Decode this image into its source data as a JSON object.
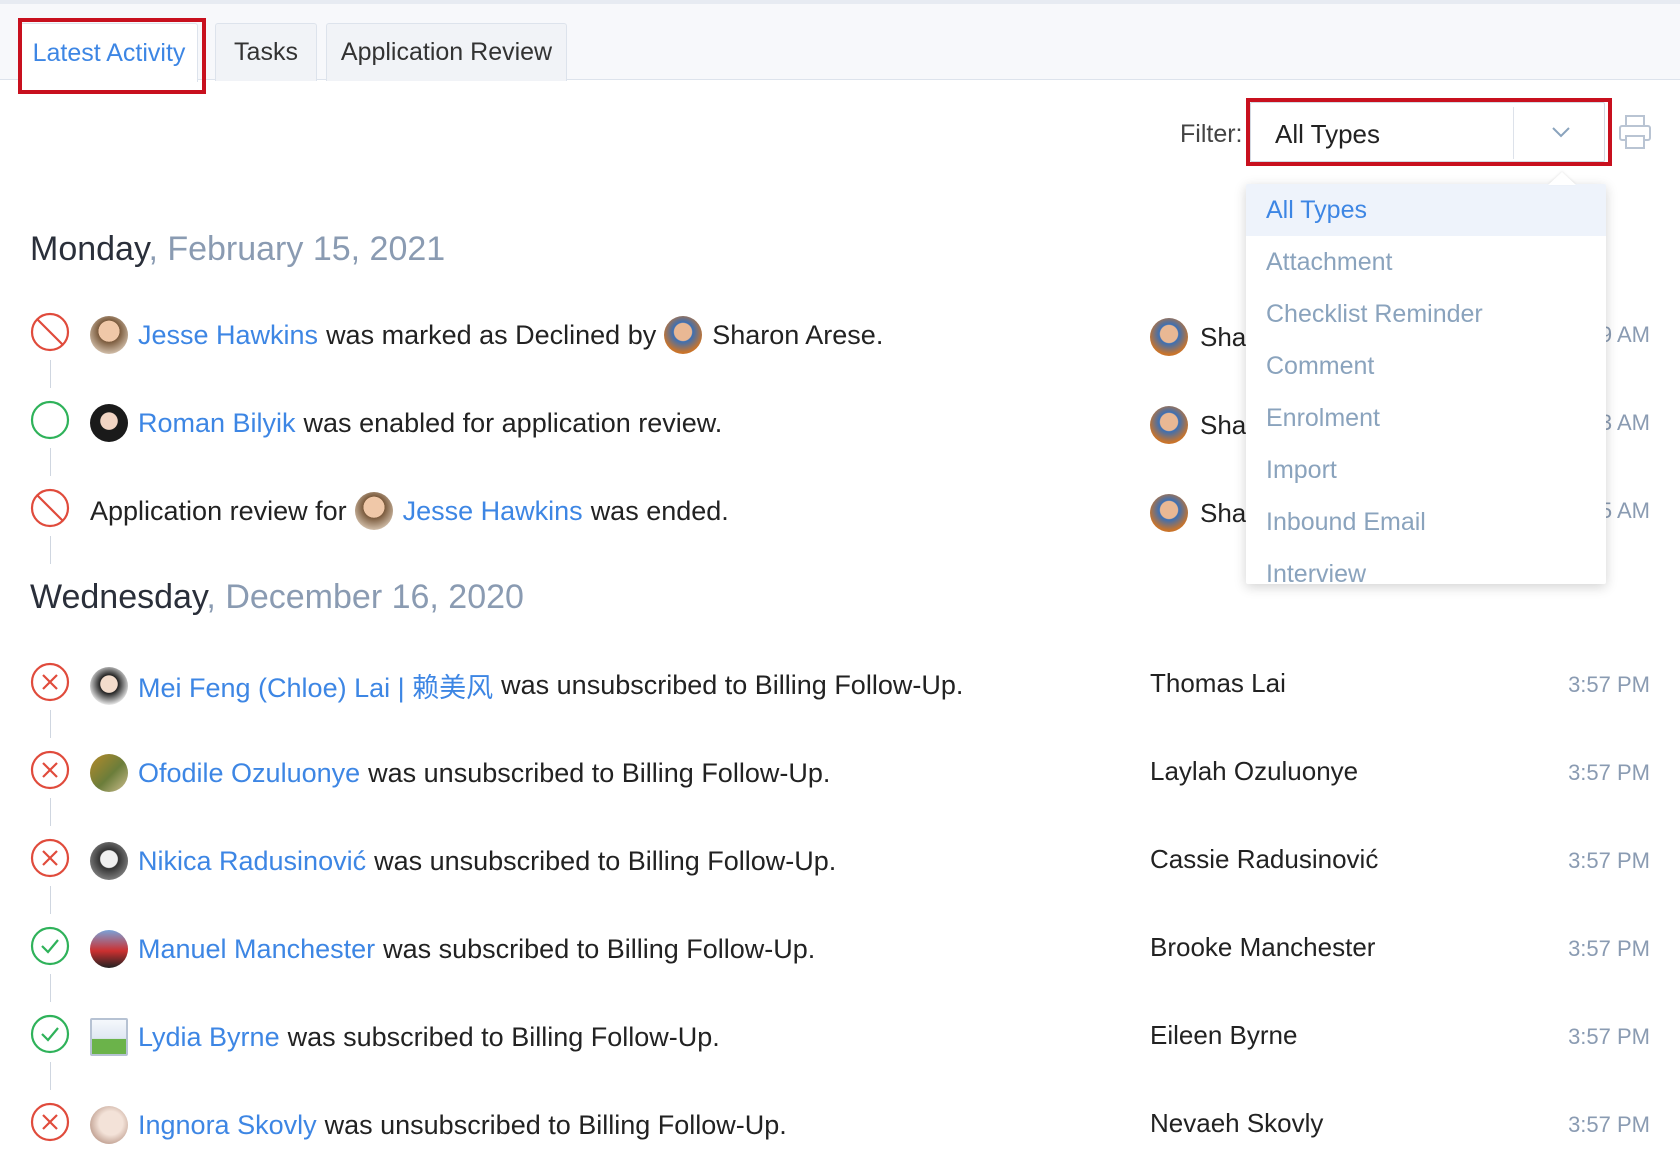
{
  "tabs": [
    {
      "label": "Latest Activity",
      "active": true
    },
    {
      "label": "Tasks",
      "active": false
    },
    {
      "label": "Application Review",
      "active": false
    }
  ],
  "filter": {
    "label": "Filter:",
    "selected": "All Types",
    "options": [
      "All Types",
      "Attachment",
      "Checklist Reminder",
      "Comment",
      "Enrolment",
      "Import",
      "Inbound Email",
      "Interview"
    ]
  },
  "days": [
    {
      "weekday": "Monday",
      "date": ", February 15, 2021"
    },
    {
      "weekday": "Wednesday",
      "date": ", December 16, 2020"
    }
  ],
  "activities": [
    {
      "status": "declined",
      "before": "",
      "name": "Jesse Hawkins",
      "after": "was marked as Declined by",
      "by": "Sharon Arese.",
      "actor": "Sha",
      "time": "9 AM"
    },
    {
      "status": "enabled",
      "before": "",
      "name": "Roman Bilyik",
      "after": "was enabled for application review.",
      "by": "",
      "actor": "Sha",
      "time": "3 AM"
    },
    {
      "status": "declined",
      "before": "Application review for",
      "name": "Jesse Hawkins",
      "after": "was ended.",
      "by": "",
      "actor": "Sha",
      "time": "5 AM"
    },
    {
      "status": "unsubscribed",
      "before": "",
      "name": "Mei Feng (Chloe) Lai | 赖美风",
      "after": "was unsubscribed to Billing Follow-Up.",
      "by": "",
      "actor": "Thomas Lai",
      "time": "3:57 PM"
    },
    {
      "status": "unsubscribed",
      "before": "",
      "name": "Ofodile Ozuluonye",
      "after": "was unsubscribed to Billing Follow-Up.",
      "by": "",
      "actor": "Laylah Ozuluonye",
      "time": "3:57 PM"
    },
    {
      "status": "unsubscribed",
      "before": "",
      "name": "Nikica Radusinović",
      "after": "was unsubscribed to Billing Follow-Up.",
      "by": "",
      "actor": "Cassie Radusinović",
      "time": "3:57 PM"
    },
    {
      "status": "subscribed",
      "before": "",
      "name": "Manuel Manchester",
      "after": "was subscribed to Billing Follow-Up.",
      "by": "",
      "actor": "Brooke Manchester",
      "time": "3:57 PM"
    },
    {
      "status": "subscribed",
      "before": "",
      "name": "Lydia Byrne",
      "after": "was subscribed to Billing Follow-Up.",
      "by": "",
      "actor": "Eileen Byrne",
      "time": "3:57 PM"
    },
    {
      "status": "unsubscribed",
      "before": "",
      "name": "Ingnora Skovly",
      "after": "was unsubscribed to Billing Follow-Up.",
      "by": "",
      "actor": "Nevaeh Skovly",
      "time": "3:57 PM"
    }
  ],
  "colors": {
    "link": "#3d86e4",
    "declined": "#e04b3c",
    "enabled": "#2fb25a",
    "highlight": "#c8101e"
  },
  "icons": {
    "status_declined": "ban-icon",
    "status_enabled": "circle-icon",
    "status_unsubscribed": "x-circle-icon",
    "status_subscribed": "check-circle-icon",
    "filter_caret": "chevron-down-icon",
    "print": "printer-icon"
  }
}
